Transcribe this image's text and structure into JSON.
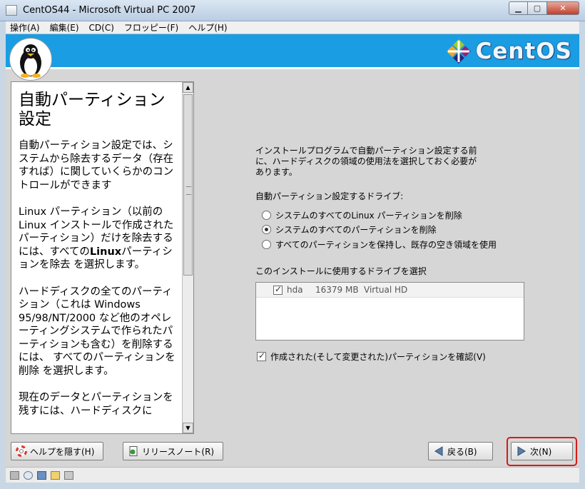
{
  "window": {
    "title": "CentOS44 - Microsoft Virtual PC 2007"
  },
  "menu": [
    "操作(A)",
    "編集(E)",
    "CD(C)",
    "フロッピー(F)",
    "ヘルプ(H)"
  ],
  "brand": {
    "logo_text": "CentOS"
  },
  "help": {
    "title": "自動パーティション設定",
    "p1": "自動パーティション設定では、システムから除去するデータ（存在すれば）に関していくらかのコントロールができます",
    "p2_a": "Linux パーティション（以前の Linux インストールで作成されたパーティション）だけを除去するには、すべての",
    "p2_bold": "Linux",
    "p2_b": "パーティションを除去 を選択します。",
    "p3": "ハードディスクの全てのパーティション（これは Windows 95/98/NT/2000 など他のオペレーティングシステムで作られたパーティションも含む）を削除するには、 すべてのパーティションを削除 を選択します。",
    "p4": "現在のデータとパーティションを残すには、ハードディスクに"
  },
  "main": {
    "intro": "インストールプログラムで自動パーティション設定する前に、ハードディスクの領域の使用法を選択しておく必要があります。",
    "drive_label": "自動パーティション設定するドライブ:",
    "options": [
      {
        "label": "システムのすべてのLinux パーティションを削除",
        "selected": false
      },
      {
        "label": "システムのすべてのパーティションを削除",
        "selected": true
      },
      {
        "label": "すべてのパーティションを保持し、既存の空き領域を使用",
        "selected": false
      }
    ],
    "select_label": "このインストールに使用するドライブを選択",
    "drives": [
      {
        "name": "hda",
        "size": "16379 MB",
        "model": "Virtual HD",
        "checked": true
      }
    ],
    "confirm_label": "作成された(そして変更された)パーティションを確認(V)",
    "confirm_checked": true
  },
  "buttons": {
    "hide_help": "ヘルプを隠す(H)",
    "release_notes": "リリースノート(R)",
    "back": "戻る(B)",
    "next": "次(N)"
  },
  "colors": {
    "banner": "#1a9de2",
    "highlight": "#d61a1a"
  },
  "icons": [
    "lifebuoy-icon",
    "document-icon",
    "back-arrow-icon",
    "next-arrow-icon",
    "tux-penguin-icon",
    "centos-logo-icon"
  ]
}
